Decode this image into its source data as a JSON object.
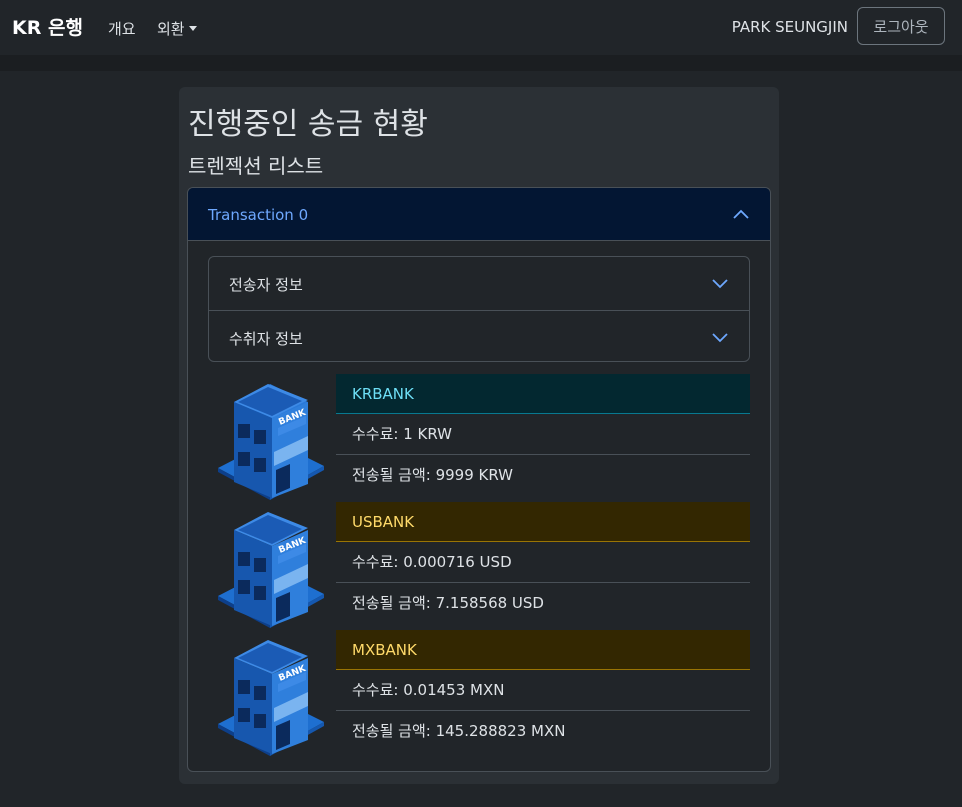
{
  "navbar": {
    "brand": "KR 은행",
    "links": [
      "개요",
      "외환"
    ],
    "user": "PARK SEUNGJIN",
    "logout": "로그아웃"
  },
  "page": {
    "title": "진행중인 송금 현황",
    "subtitle": "트렌젝션 리스트"
  },
  "transaction": {
    "header": "Transaction 0",
    "sections": [
      "전송자 정보",
      "수취자 정보"
    ],
    "banks": [
      {
        "name": "KRBANK",
        "fee": "수수료: 1 KRW",
        "amount": "전송될 금액: 9999 KRW",
        "head_bg": "#032830",
        "head_fg": "#6edff6",
        "head_border": "#087990"
      },
      {
        "name": "USBANK",
        "fee": "수수료: 0.000716 USD",
        "amount": "전송될 금액: 7.158568 USD",
        "head_bg": "#332701",
        "head_fg": "#ffda6a",
        "head_border": "#997404"
      },
      {
        "name": "MXBANK",
        "fee": "수수료: 0.01453 MXN",
        "amount": "전송될 금액: 145.288823 MXN",
        "head_bg": "#332701",
        "head_fg": "#ffda6a",
        "head_border": "#997404"
      }
    ]
  },
  "icons": {
    "chevron_up": "chevron-up-icon",
    "chevron_down": "chevron-down-icon",
    "bank": "bank-building-icon",
    "bank_sign": "BANK"
  }
}
